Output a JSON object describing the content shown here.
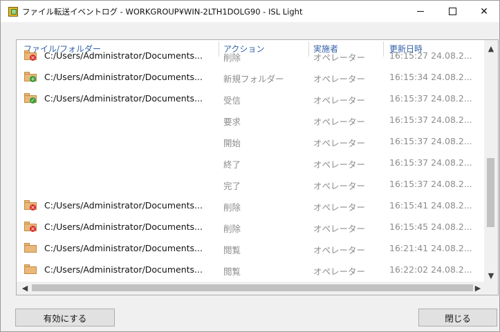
{
  "window": {
    "title": "ファイル転送イベントログ - WORKGROUP¥WIN-2LTH1DOLG90 - ISL Light",
    "controls": {
      "minimize": "—",
      "maximize": "☐",
      "close": "✕"
    }
  },
  "columns": {
    "file": "ファイル/フォルダー",
    "action": "アクション",
    "by": "実施者",
    "date": "更新日時"
  },
  "rows": [
    {
      "icon": "folder-delete-icon",
      "file": "C:/Users/Administrator/Documents...",
      "action": "削除",
      "by": "オペレーター",
      "date": "16:15:27 24.08.2..."
    },
    {
      "icon": "folder-new-icon",
      "file": "C:/Users/Administrator/Documents...",
      "action": "新規フォルダー",
      "by": "オペレーター",
      "date": "16:15:34 24.08.2..."
    },
    {
      "icon": "folder-receive-icon",
      "file": "C:/Users/Administrator/Documents...",
      "action": "受信",
      "by": "オペレーター",
      "date": "16:15:37 24.08.2..."
    },
    {
      "icon": "",
      "file": "",
      "action": "要求",
      "by": "オペレーター",
      "date": "16:15:37 24.08.2..."
    },
    {
      "icon": "",
      "file": "",
      "action": "開始",
      "by": "オペレーター",
      "date": "16:15:37 24.08.2..."
    },
    {
      "icon": "",
      "file": "",
      "action": "終了",
      "by": "オペレーター",
      "date": "16:15:37 24.08.2..."
    },
    {
      "icon": "",
      "file": "",
      "action": "完了",
      "by": "オペレーター",
      "date": "16:15:37 24.08.2..."
    },
    {
      "icon": "folder-delete-icon",
      "file": "C:/Users/Administrator/Documents...",
      "action": "削除",
      "by": "オペレーター",
      "date": "16:15:41 24.08.2..."
    },
    {
      "icon": "folder-delete-icon",
      "file": "C:/Users/Administrator/Documents...",
      "action": "削除",
      "by": "オペレーター",
      "date": "16:15:45 24.08.2..."
    },
    {
      "icon": "folder-icon",
      "file": "C:/Users/Administrator/Documents...",
      "action": "閲覧",
      "by": "オペレーター",
      "date": "16:21:41 24.08.2..."
    },
    {
      "icon": "folder-icon",
      "file": "C:/Users/Administrator/Documents...",
      "action": "閲覧",
      "by": "オペレーター",
      "date": "16:22:02 24.08.2..."
    }
  ],
  "buttons": {
    "enable": "有効にする",
    "close": "閉じる"
  },
  "colors": {
    "header_text": "#2f5fa7",
    "muted_text": "#8c8c8c",
    "folder": "#e9b87a",
    "delete_badge": "#d8302f",
    "new_badge": "#3a9d3a"
  }
}
